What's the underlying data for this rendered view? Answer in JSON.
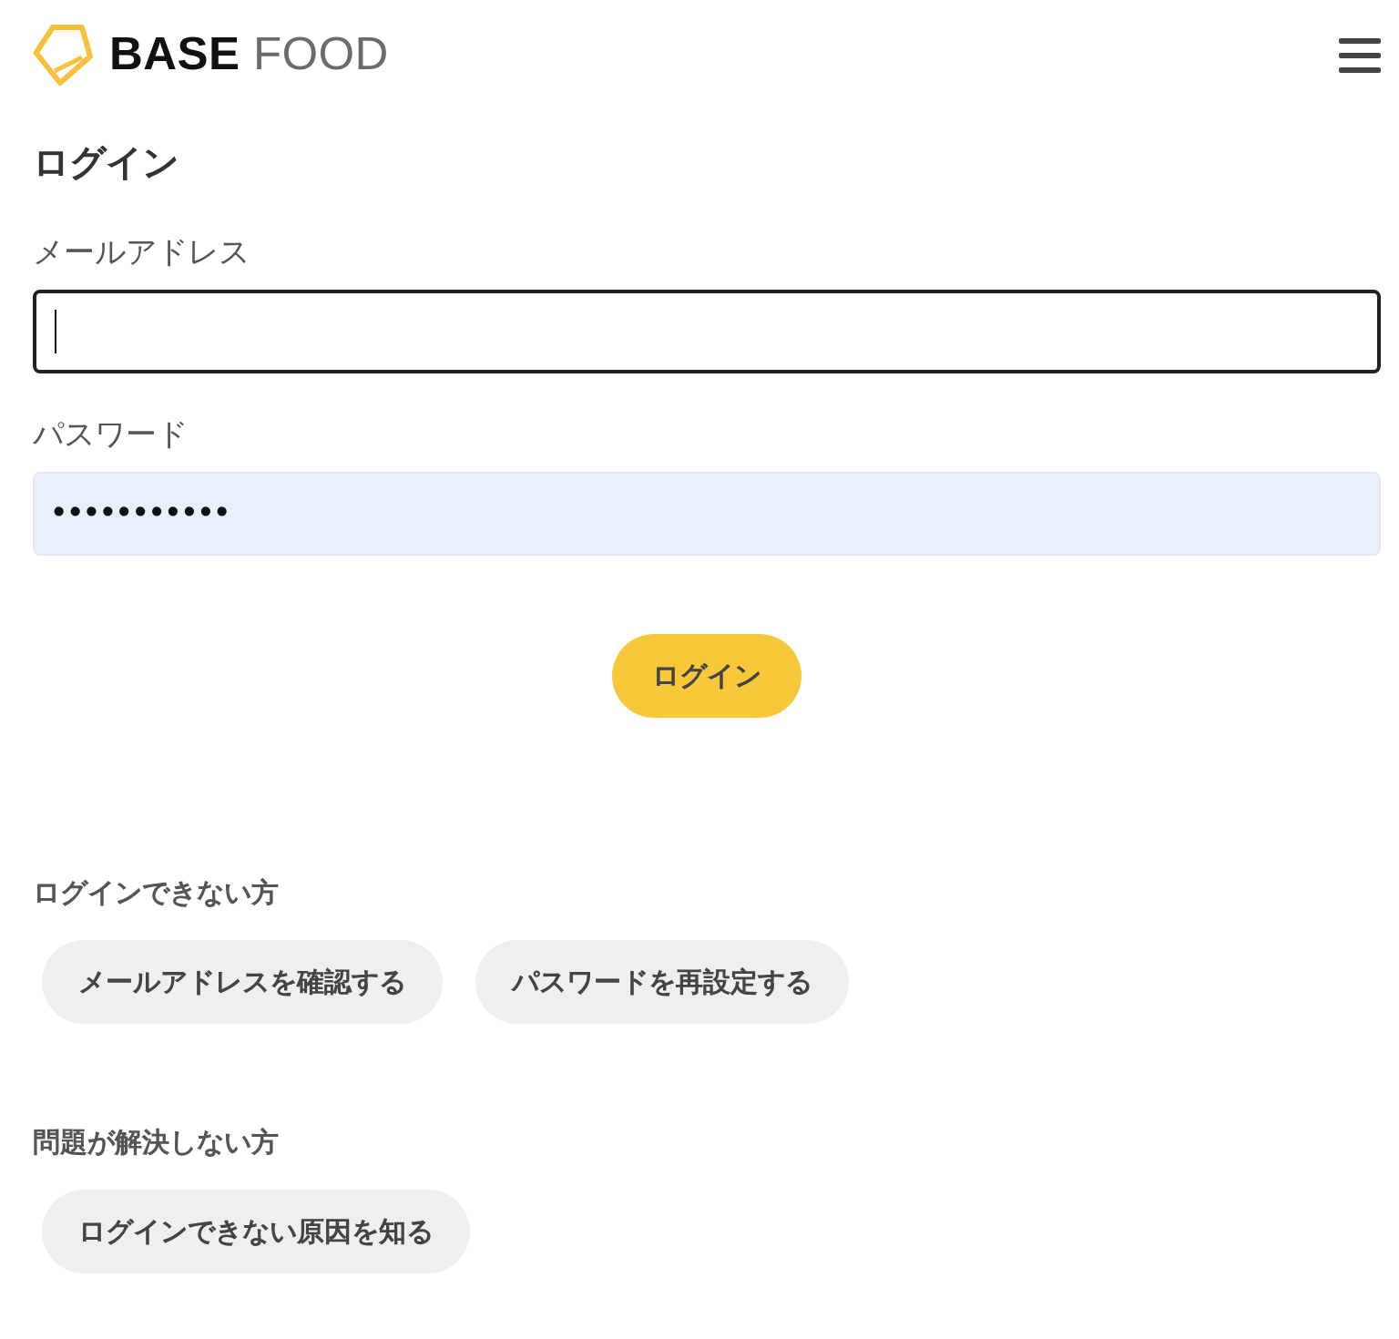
{
  "header": {
    "logo_text": "**BASE** FOOD"
  },
  "title": "ログイン",
  "form": {
    "fields": [
      {
        "label": "メールアドレス",
        "focused": true,
        "autofilled": false
      },
      {
        "label": "パスワード",
        "value": "•••••••••••",
        "focused": false,
        "autofilled": true
      }
    ],
    "submit": "ログイン"
  },
  "help_sections": [
    {
      "heading": "ログインできない方",
      "buttons": [
        "メールアドレスを確認する",
        "パスワードを再設定する"
      ]
    },
    {
      "heading": "問題が解決しない方",
      "buttons": [
        "ログインできない原因を知る"
      ]
    }
  ]
}
